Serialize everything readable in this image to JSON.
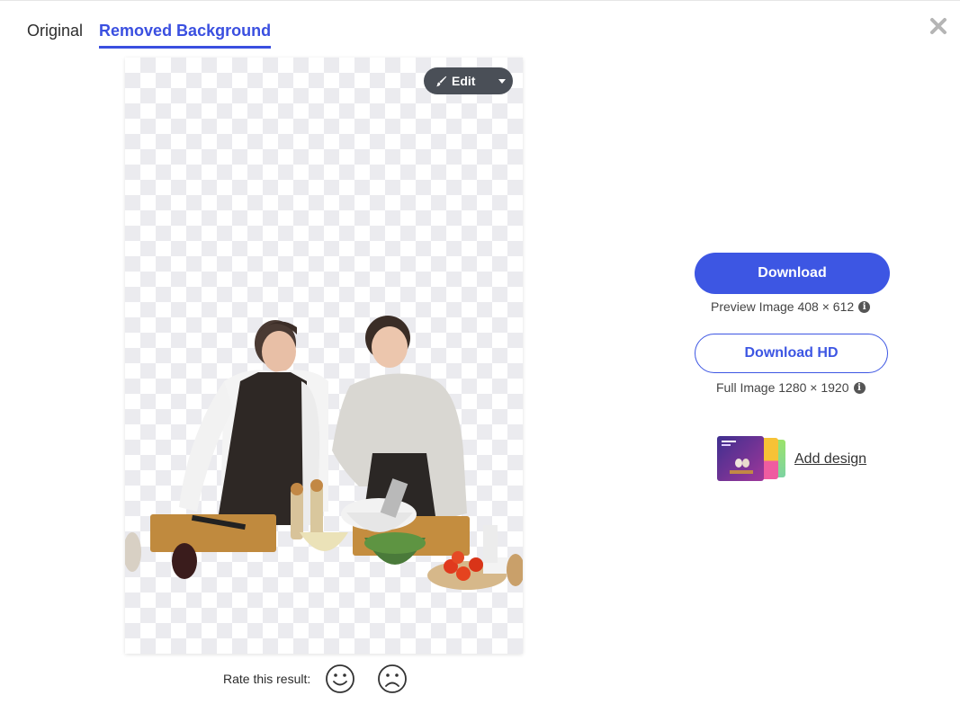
{
  "tabs": [
    {
      "label": "Original",
      "active": false
    },
    {
      "label": "Removed Background",
      "active": true
    }
  ],
  "toolbar": {
    "edit_label": "Edit",
    "edit_icon": "brush-icon",
    "menu_icon": "caret-down-icon"
  },
  "rating": {
    "label": "Rate this result:",
    "icons": [
      "smile-icon",
      "frown-icon"
    ]
  },
  "download": {
    "label": "Download",
    "info": "Preview Image 408 × 612"
  },
  "download_hd": {
    "label": "Download HD",
    "info": "Full Image 1280 × 1920"
  },
  "add_design": {
    "label": "Add design"
  },
  "colors": {
    "accent": "#3d56e3",
    "edit_bg": "#4a4f57",
    "checker": "#ebebef"
  }
}
